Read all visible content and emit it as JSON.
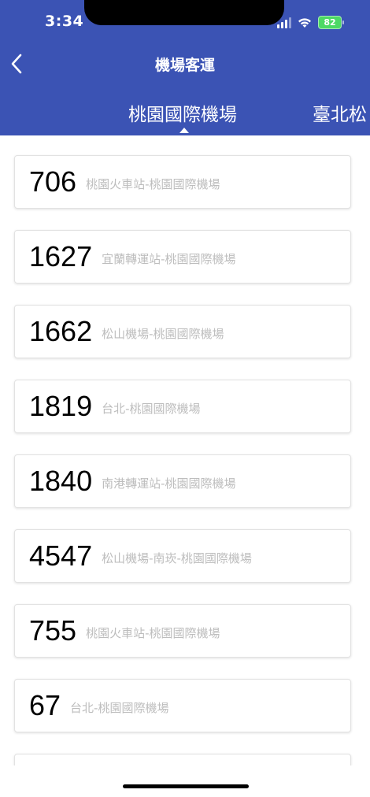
{
  "status_bar": {
    "time": "3:34",
    "battery": "82"
  },
  "header": {
    "title": "機場客運",
    "tabs": [
      {
        "label": "桃園國際機場",
        "active": true
      },
      {
        "label": "臺北松",
        "active": false
      }
    ]
  },
  "colors": {
    "header_bg": "#3b53b4",
    "battery": "#4cd964",
    "description_text": "#bdbdbd"
  },
  "routes": [
    {
      "number": "706",
      "desc": "桃園火車站-桃園國際機場"
    },
    {
      "number": "1627",
      "desc": "宜蘭轉運站-桃園國際機場"
    },
    {
      "number": "1662",
      "desc": "松山機場-桃園國際機場"
    },
    {
      "number": "1819",
      "desc": "台北-桃園國際機場"
    },
    {
      "number": "1840",
      "desc": "南港轉運站-桃園國際機場"
    },
    {
      "number": "4547",
      "desc": "松山機場-南崁-桃園國際機場"
    },
    {
      "number": "755",
      "desc": "桃園火車站-桃園國際機場"
    },
    {
      "number": "67",
      "desc": "台北-桃園國際機場"
    }
  ]
}
